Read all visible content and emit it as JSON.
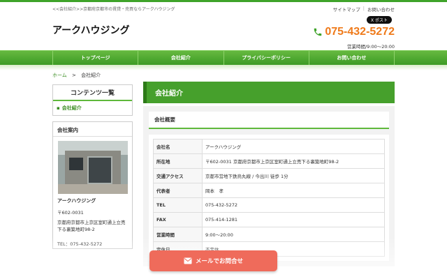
{
  "header": {
    "tagline": "<<会社紹介>>京都府京都市の賃貸・売買ならアークハウジング",
    "links": [
      "サイトマップ",
      "お問い合わせ"
    ],
    "xpost": "X ポスト",
    "logo": "アークハウジング",
    "phone": "075-432-5272",
    "hours": "営業時間/9:00～20:00"
  },
  "nav": [
    "トップページ",
    "会社紹介",
    "プライバシーポリシー",
    "お問い合わせ"
  ],
  "breadcrumb": {
    "home": "ホーム",
    "sep": ">",
    "current": "会社紹介"
  },
  "sidebar": {
    "contents_title": "コンテンツ一覧",
    "contents_item": "会社紹介",
    "info_title": "会社案内",
    "company": "アークハウジング",
    "zip": "〒602-0031",
    "address": "京都府京都市上京区室町通上立売下る裏築地町98-2",
    "tel": "TEL：075-432-5272"
  },
  "main": {
    "title": "会社紹介",
    "section": "会社概要",
    "rows": [
      {
        "label": "会社名",
        "value": "アークハウジング"
      },
      {
        "label": "所在地",
        "value": "〒602-0031 京都府京都市上京区室町通上立売下る裏築地町98-2"
      },
      {
        "label": "交通アクセス",
        "value": "京都市営地下鉄烏丸線 / 今出川 徒歩 1分"
      },
      {
        "label": "代表者",
        "value": "岡本　孝"
      },
      {
        "label": "TEL",
        "value": "075-432-5272"
      },
      {
        "label": "FAX",
        "value": "075-414-1281"
      },
      {
        "label": "営業時間",
        "value": "9:00～20:00"
      },
      {
        "label": "定休日",
        "value": "不定休"
      }
    ]
  },
  "mail_button": "メールでお問合せ",
  "colors": {
    "green": "#46a02c",
    "orange": "#ef7a1a",
    "mail": "#ef6b5b"
  }
}
